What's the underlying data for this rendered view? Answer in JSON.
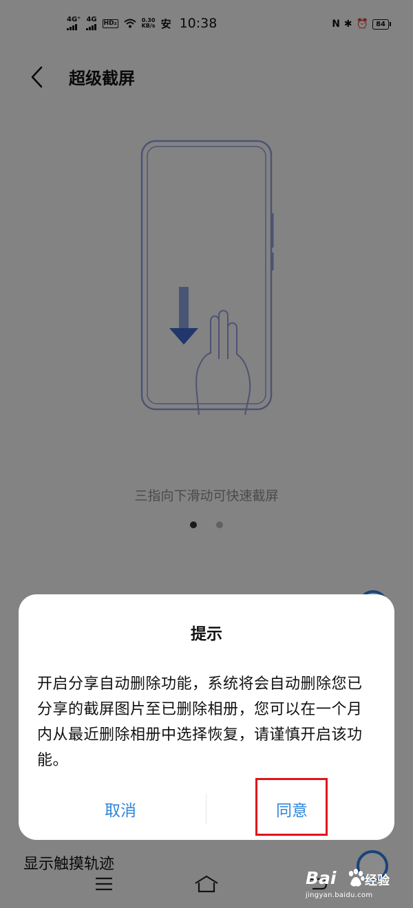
{
  "status_bar": {
    "sim1": "4G⁺",
    "sim2": "4G",
    "hd": "HD₂",
    "speed_value": "0.30",
    "speed_unit": "KB/s",
    "app_badge": "安",
    "time": "10:38",
    "battery": "84",
    "nfc": "N",
    "bluetooth_glyph": "✱",
    "alarm_glyph": "⏰"
  },
  "header": {
    "title": "超级截屏"
  },
  "illustration": {
    "caption": "三指向下滑动可快速截屏"
  },
  "background_row": {
    "label": "显示触摸轨迹"
  },
  "dialog": {
    "title": "提示",
    "message": "开启分享自动删除功能，系统将会自动删除您已分享的截屏图片至已删除相册，您可以在一个月内从最近删除相册中选择恢复，请谨慎开启该功能。",
    "cancel_label": "取消",
    "agree_label": "同意"
  },
  "watermark": {
    "brand": "Bai",
    "cn": "经验",
    "url": "jingyan.baidu.com"
  },
  "colors": {
    "accent": "#2f86d8",
    "highlight": "#e0131a",
    "illustration": "#8e9ad6"
  }
}
